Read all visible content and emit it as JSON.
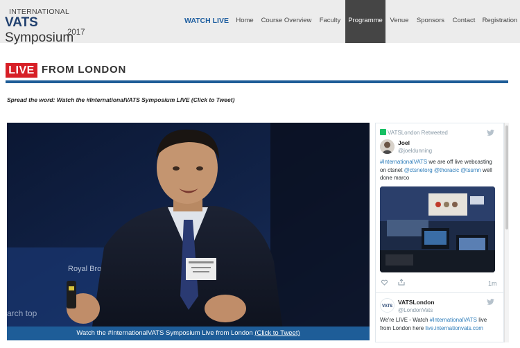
{
  "logo": {
    "line1": "INTERNATIONAL",
    "line2_a": "VATS",
    "line2_b": "Symposium",
    "line3": "2017"
  },
  "nav": {
    "items": [
      {
        "label": "WATCH LIVE"
      },
      {
        "label": "Home"
      },
      {
        "label": "Course Overview"
      },
      {
        "label": "Faculty"
      },
      {
        "label": "Programme"
      },
      {
        "label": "Venue"
      },
      {
        "label": "Sponsors"
      },
      {
        "label": "Contact"
      },
      {
        "label": "Registration"
      }
    ],
    "active": "Programme"
  },
  "live": {
    "badge": "LIVE",
    "rest": "FROM LONDON"
  },
  "spread": "Spread the word: Watch the #InternationalVATS Symposium LIVE (Click to Tweet)",
  "video": {
    "backdrop_text_1": "Royal Bro",
    "backdrop_text_2": "arch top",
    "caption_main": "Watch the #InternationalVATS Symposium Live from London",
    "caption_link": "(Click to Tweet)"
  },
  "twitter": {
    "tweet1": {
      "retweet_line": "VATSLondon Retweeted",
      "name": "Joel",
      "handle": "@joeldunning",
      "text_a": "#InternationalVATS",
      "text_b": " we are off live webcasting on ctsnet ",
      "text_c": "@ctsnetorg @thoracic @tssmn",
      "text_d": " well done marco",
      "time": "1m"
    },
    "tweet2": {
      "name": "VATSLondon",
      "handle": "@LondonVats",
      "text_a": "We're LIVE -  Watch ",
      "text_b": "#InternationalVATS",
      "text_c": " live from London here ",
      "text_d": "live.internationvats.com"
    }
  },
  "colors": {
    "accent_blue": "#1e5d98",
    "live_red": "#d71f26",
    "nav_active_bg": "#454545",
    "twitter_link": "#2b7bb9"
  }
}
